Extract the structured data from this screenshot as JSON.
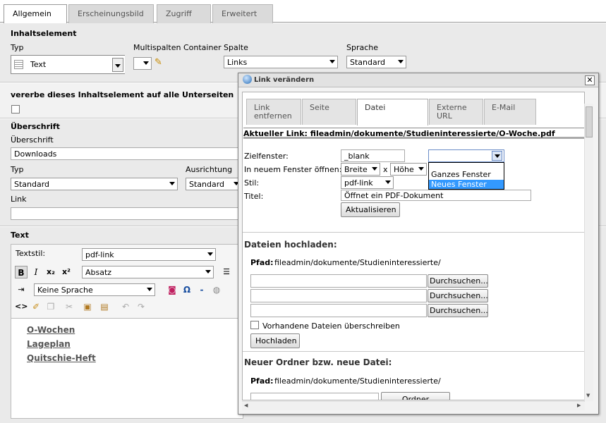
{
  "tabs": [
    "Allgemein",
    "Erscheinungsbild",
    "Zugriff",
    "Erweitert"
  ],
  "inhalt": {
    "heading": "Inhaltselement",
    "typ_label": "Typ",
    "typ_value": "Text",
    "multicol_label": "Multispalten Container",
    "spalte_label": "Spalte",
    "spalte_value": "Links",
    "sprache_label": "Sprache",
    "sprache_value": "Standard"
  },
  "inherit_label": "vererbe dieses Inhaltselement auf alle Unterseiten",
  "header": {
    "heading": "Überschrift",
    "label": "Überschrift",
    "value": "Downloads",
    "typ_label": "Typ",
    "typ_value": "Standard",
    "align_label": "Ausrichtung",
    "align_value": "Standard",
    "link_label": "Link"
  },
  "text": {
    "heading": "Text",
    "style_label": "Textstil:",
    "style_value": "pdf-link",
    "block_value": "Absatz",
    "lang_value": "Keine Sprache",
    "links": [
      "O-Wochen",
      "Lageplan",
      "Quitschie-Heft"
    ]
  },
  "dialog": {
    "title": "Link verändern",
    "tabs": [
      "Link entfernen",
      "Seite",
      "Datei",
      "Externe URL",
      "E-Mail"
    ],
    "current_link": "Aktueller Link: fileadmin/dokumente/Studieninteressierte/O-Woche.pdf",
    "target_label": "Zielfenster:",
    "target_value": "_blank",
    "target_options": [
      "Ganzes Fenster",
      "Neues Fenster"
    ],
    "newwin_label": "In neuem Fenster öffnen:",
    "width_value": "Breite",
    "x_sep": "x",
    "height_value": "Höhe",
    "style_label": "Stil:",
    "style_value": "pdf-link",
    "title_label": "Titel:",
    "title_value": "Öffnet ein PDF-Dokument",
    "update_button": "Aktualisieren",
    "upload_heading": "Dateien hochladen:",
    "path_label": "Pfad:",
    "path_value": "fileadmin/dokumente/Studieninteressierte/",
    "browse_button": "Durchsuchen...",
    "overwrite_label": "Vorhandene Dateien überschreiben",
    "upload_button": "Hochladen",
    "folder_heading": "Neuer Ordner bzw. neue Datei:",
    "folder_path_label": "Pfad:",
    "folder_path_value": "fileadmin/dokumente/Studieninteressierte/",
    "create_folder_button": "Ordner anlegen"
  }
}
